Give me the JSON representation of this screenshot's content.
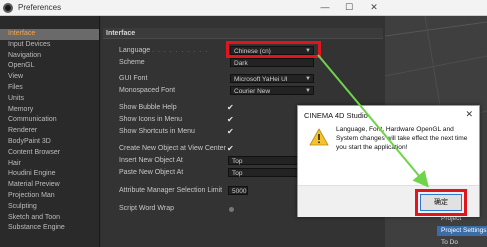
{
  "window": {
    "title": "Preferences",
    "minimize_icon": "minimize-icon",
    "maximize_icon": "maximize-icon",
    "close_icon": "close-icon"
  },
  "sidebar": {
    "items": [
      {
        "label": "Interface",
        "active": true
      },
      {
        "label": "Input Devices"
      },
      {
        "label": "Navigation"
      },
      {
        "label": "OpenGL"
      },
      {
        "label": "View"
      },
      {
        "label": "Files"
      },
      {
        "label": "Units"
      },
      {
        "label": "Memory"
      },
      {
        "label": "Communication"
      },
      {
        "label": "Renderer"
      },
      {
        "label": "BodyPaint 3D"
      },
      {
        "label": "Content Browser"
      },
      {
        "label": "Hair"
      },
      {
        "label": "Houdini Engine"
      },
      {
        "label": "Material Preview"
      },
      {
        "label": "Projection Man"
      },
      {
        "label": "Sculpting"
      },
      {
        "label": "Sketch and Toon"
      },
      {
        "label": "Substance Engine"
      }
    ]
  },
  "panel": {
    "header": "Interface",
    "language": {
      "label": "Language",
      "value": "Chinese (cn)"
    },
    "scheme": {
      "label": "Scheme",
      "value": "Dark"
    },
    "gui_font": {
      "label": "GUI Font",
      "value": "Microsoft YaHei UI"
    },
    "mono_font": {
      "label": "Monospaced Font",
      "value": "Courier New"
    },
    "bubble_help": {
      "label": "Show Bubble Help"
    },
    "icons_menu": {
      "label": "Show Icons in Menu"
    },
    "shortcuts_menu": {
      "label": "Show Shortcuts in Menu"
    },
    "create_new": {
      "label": "Create New Object at View Center"
    },
    "insert_new": {
      "label": "Insert New Object At",
      "value": "Top"
    },
    "paste_new": {
      "label": "Paste New Object At",
      "value": "Top"
    },
    "attr_limit": {
      "label": "Attribute Manager Selection Limit",
      "value": "5000"
    },
    "script_wrap": {
      "label": "Script Word Wrap"
    },
    "dots": ". . . . . . . . . ."
  },
  "right_panel": {
    "items": [
      {
        "label": "Project"
      },
      {
        "label": "Project Settings"
      },
      {
        "label": "To Do"
      }
    ]
  },
  "dialog": {
    "title": "CINEMA 4D Studio",
    "close_icon": "close-icon",
    "icon": "warning-icon",
    "message": "Language, Font, Hardware OpenGL and System changes will take effect the next time you start the application!",
    "ok_label": "确定"
  },
  "colors": {
    "highlight_red": "#e1161c",
    "arrow_green": "#6fd44a",
    "accent_orange": "#f6a54a"
  }
}
